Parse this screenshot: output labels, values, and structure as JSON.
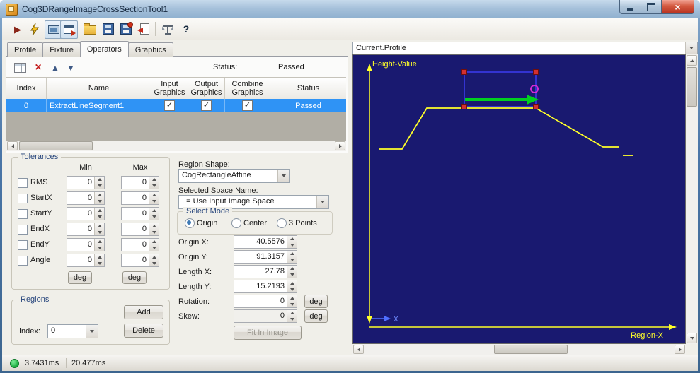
{
  "window": {
    "title": "Cog3DRangeImageCrossSectionTool1"
  },
  "glyphs": {
    "play": "▶",
    "delete_x": "×",
    "arrow_up": "▲",
    "arrow_down": "▼",
    "check": "✓",
    "close": "×",
    "help": "?"
  },
  "tabs": {
    "items": [
      {
        "label": "Profile"
      },
      {
        "label": "Fixture"
      },
      {
        "label": "Operators"
      },
      {
        "label": "Graphics"
      }
    ]
  },
  "operators": {
    "status_label": "Status:",
    "status_value": "Passed",
    "grid": {
      "headers": {
        "index": "Index",
        "name": "Name",
        "input": "Input Graphics",
        "output": "Output Graphics",
        "combine": "Combine Graphics",
        "status": "Status"
      },
      "row": {
        "index": "0",
        "name": "ExtractLineSegment1",
        "status": "Passed"
      }
    }
  },
  "tolerances": {
    "title": "Tolerances",
    "min_header": "Min",
    "max_header": "Max",
    "deg": "deg",
    "rows": [
      {
        "label": "RMS",
        "min": "0",
        "max": "0"
      },
      {
        "label": "StartX",
        "min": "0",
        "max": "0"
      },
      {
        "label": "StartY",
        "min": "0",
        "max": "0"
      },
      {
        "label": "EndX",
        "min": "0",
        "max": "0"
      },
      {
        "label": "EndY",
        "min": "0",
        "max": "0"
      },
      {
        "label": "Angle",
        "min": "0",
        "max": "0"
      }
    ]
  },
  "regions": {
    "title": "Regions",
    "add": "Add",
    "delete": "Delete",
    "index_label": "Index:",
    "index_value": "0"
  },
  "shape": {
    "region_shape_label": "Region Shape:",
    "region_shape_value": "CogRectangleAffine",
    "space_label": "Selected Space Name:",
    "space_value": ". = Use Input Image Space",
    "select_mode_title": "Select Mode",
    "modes": [
      {
        "label": "Origin"
      },
      {
        "label": "Center"
      },
      {
        "label": "3 Points"
      }
    ],
    "fields": [
      {
        "label": "Origin X:",
        "value": "40.5576"
      },
      {
        "label": "Origin Y:",
        "value": "91.3157"
      },
      {
        "label": "Length X:",
        "value": "27.78"
      },
      {
        "label": "Length Y:",
        "value": "15.2193"
      },
      {
        "label": "Rotation:",
        "value": "0"
      },
      {
        "label": "Skew:",
        "value": "0"
      }
    ],
    "deg": "deg",
    "fit_button": "Fit In Image"
  },
  "display": {
    "selector_value": "Current.Profile",
    "y_axis_label": "Height-Value",
    "x_axis_label": "Region-X",
    "axis_marker": "X"
  },
  "statusbar": {
    "run_time": "3.7431ms",
    "total_time": "20.477ms"
  }
}
